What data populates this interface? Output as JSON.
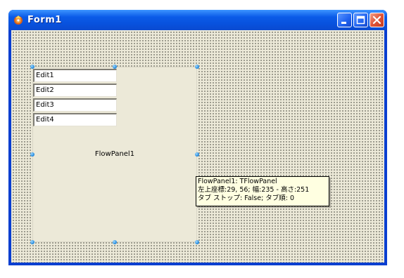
{
  "window": {
    "title": "Form1",
    "buttons": {
      "minimize": "minimize",
      "maximize": "maximize",
      "close": "close"
    }
  },
  "form": {
    "flowpanel": {
      "caption": "FlowPanel1",
      "edits": [
        "Edit1",
        "Edit2",
        "Edit3",
        "Edit4"
      ]
    },
    "tooltip": {
      "line1": "FlowPanel1: TFlowPanel",
      "line2": "左上座標:29, 56; 幅:235 - 高さ:251",
      "line3": "タブ ストップ: False; タブ順: 0"
    }
  },
  "colors": {
    "titlebar": "#0a4ad0",
    "client": "#ece9d8",
    "tooltip_bg": "#ffffe1",
    "handle": "#2a8fe0"
  },
  "icons": {
    "app": "delphi-form-icon",
    "minimize": "minimize-icon",
    "maximize": "maximize-icon",
    "close": "close-icon"
  }
}
